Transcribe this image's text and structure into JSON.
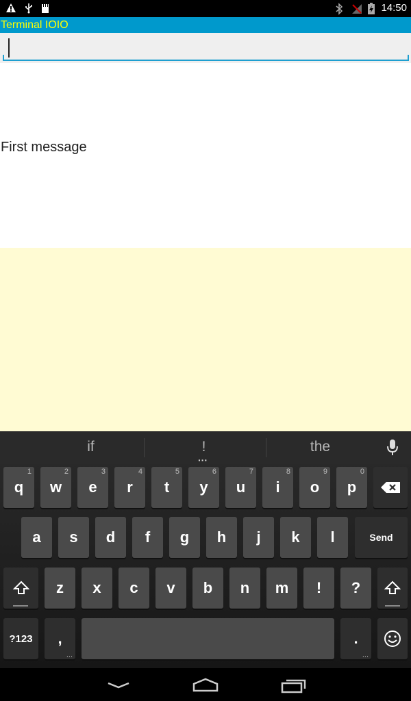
{
  "status_bar": {
    "time": "14:50",
    "icons": [
      "warning-icon",
      "usb-icon",
      "sd-card-icon",
      "bluetooth-icon",
      "no-signal-icon",
      "battery-charging-icon"
    ]
  },
  "app": {
    "title": "Terminal IOIO"
  },
  "input": {
    "value": "",
    "placeholder": ""
  },
  "messages": [
    "First message"
  ],
  "keyboard": {
    "suggestions": [
      "if",
      "!",
      "the"
    ],
    "row1": [
      {
        "label": "q",
        "hint": "1"
      },
      {
        "label": "w",
        "hint": "2"
      },
      {
        "label": "e",
        "hint": "3"
      },
      {
        "label": "r",
        "hint": "4"
      },
      {
        "label": "t",
        "hint": "5"
      },
      {
        "label": "y",
        "hint": "6"
      },
      {
        "label": "u",
        "hint": "7"
      },
      {
        "label": "i",
        "hint": "8"
      },
      {
        "label": "o",
        "hint": "9"
      },
      {
        "label": "p",
        "hint": "0"
      }
    ],
    "row2": [
      "a",
      "s",
      "d",
      "f",
      "g",
      "h",
      "j",
      "k",
      "l"
    ],
    "row3": [
      "z",
      "x",
      "c",
      "v",
      "b",
      "n",
      "m",
      "!",
      "?"
    ],
    "send_label": "Send",
    "symbols_label": "?123",
    "comma_label": ",",
    "period_label": "."
  },
  "colors": {
    "title_bar": "#0099cc",
    "title_text": "#ffff00",
    "yellow_panel": "#fffbd3"
  }
}
